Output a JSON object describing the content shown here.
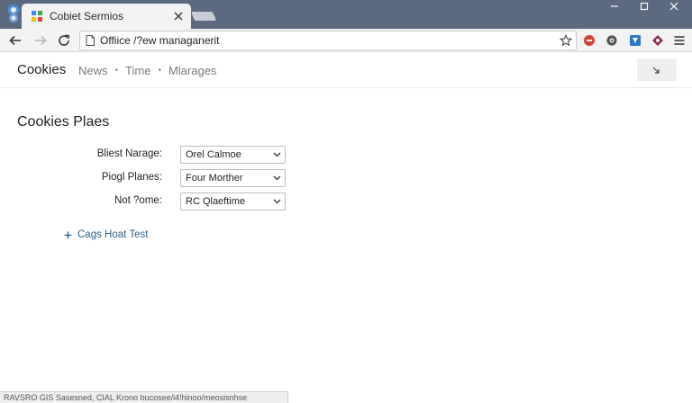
{
  "browser": {
    "tab": {
      "title": "Cobiet Sermios"
    },
    "address": {
      "value": "Offiice /?ew managanerit"
    }
  },
  "header": {
    "title": "Cookies",
    "nav": [
      "News",
      "Time",
      "Mlarages"
    ],
    "separator": "•"
  },
  "main": {
    "section_title": "Cookies Plaes",
    "rows": [
      {
        "label": "Bliest Narage:",
        "value": "Orel Calmoe"
      },
      {
        "label": "Piogl Planes:",
        "value": "Four Morther"
      },
      {
        "label": "Not ?ome:",
        "value": "RC Qlaeftime"
      }
    ],
    "add_link": "Cags Hoat Test"
  },
  "status": {
    "text": "RAVSRO GIS Sasesned, CIAL Krono bucosee/i4!hinoo/meosisnhse"
  },
  "colors": {
    "tabstrip": "#5b6a80",
    "accent_link": "#2b5e86",
    "ext_red": "#d1443a",
    "ext_blue": "#2a78c5",
    "ext_maroon": "#8b2d4a"
  }
}
